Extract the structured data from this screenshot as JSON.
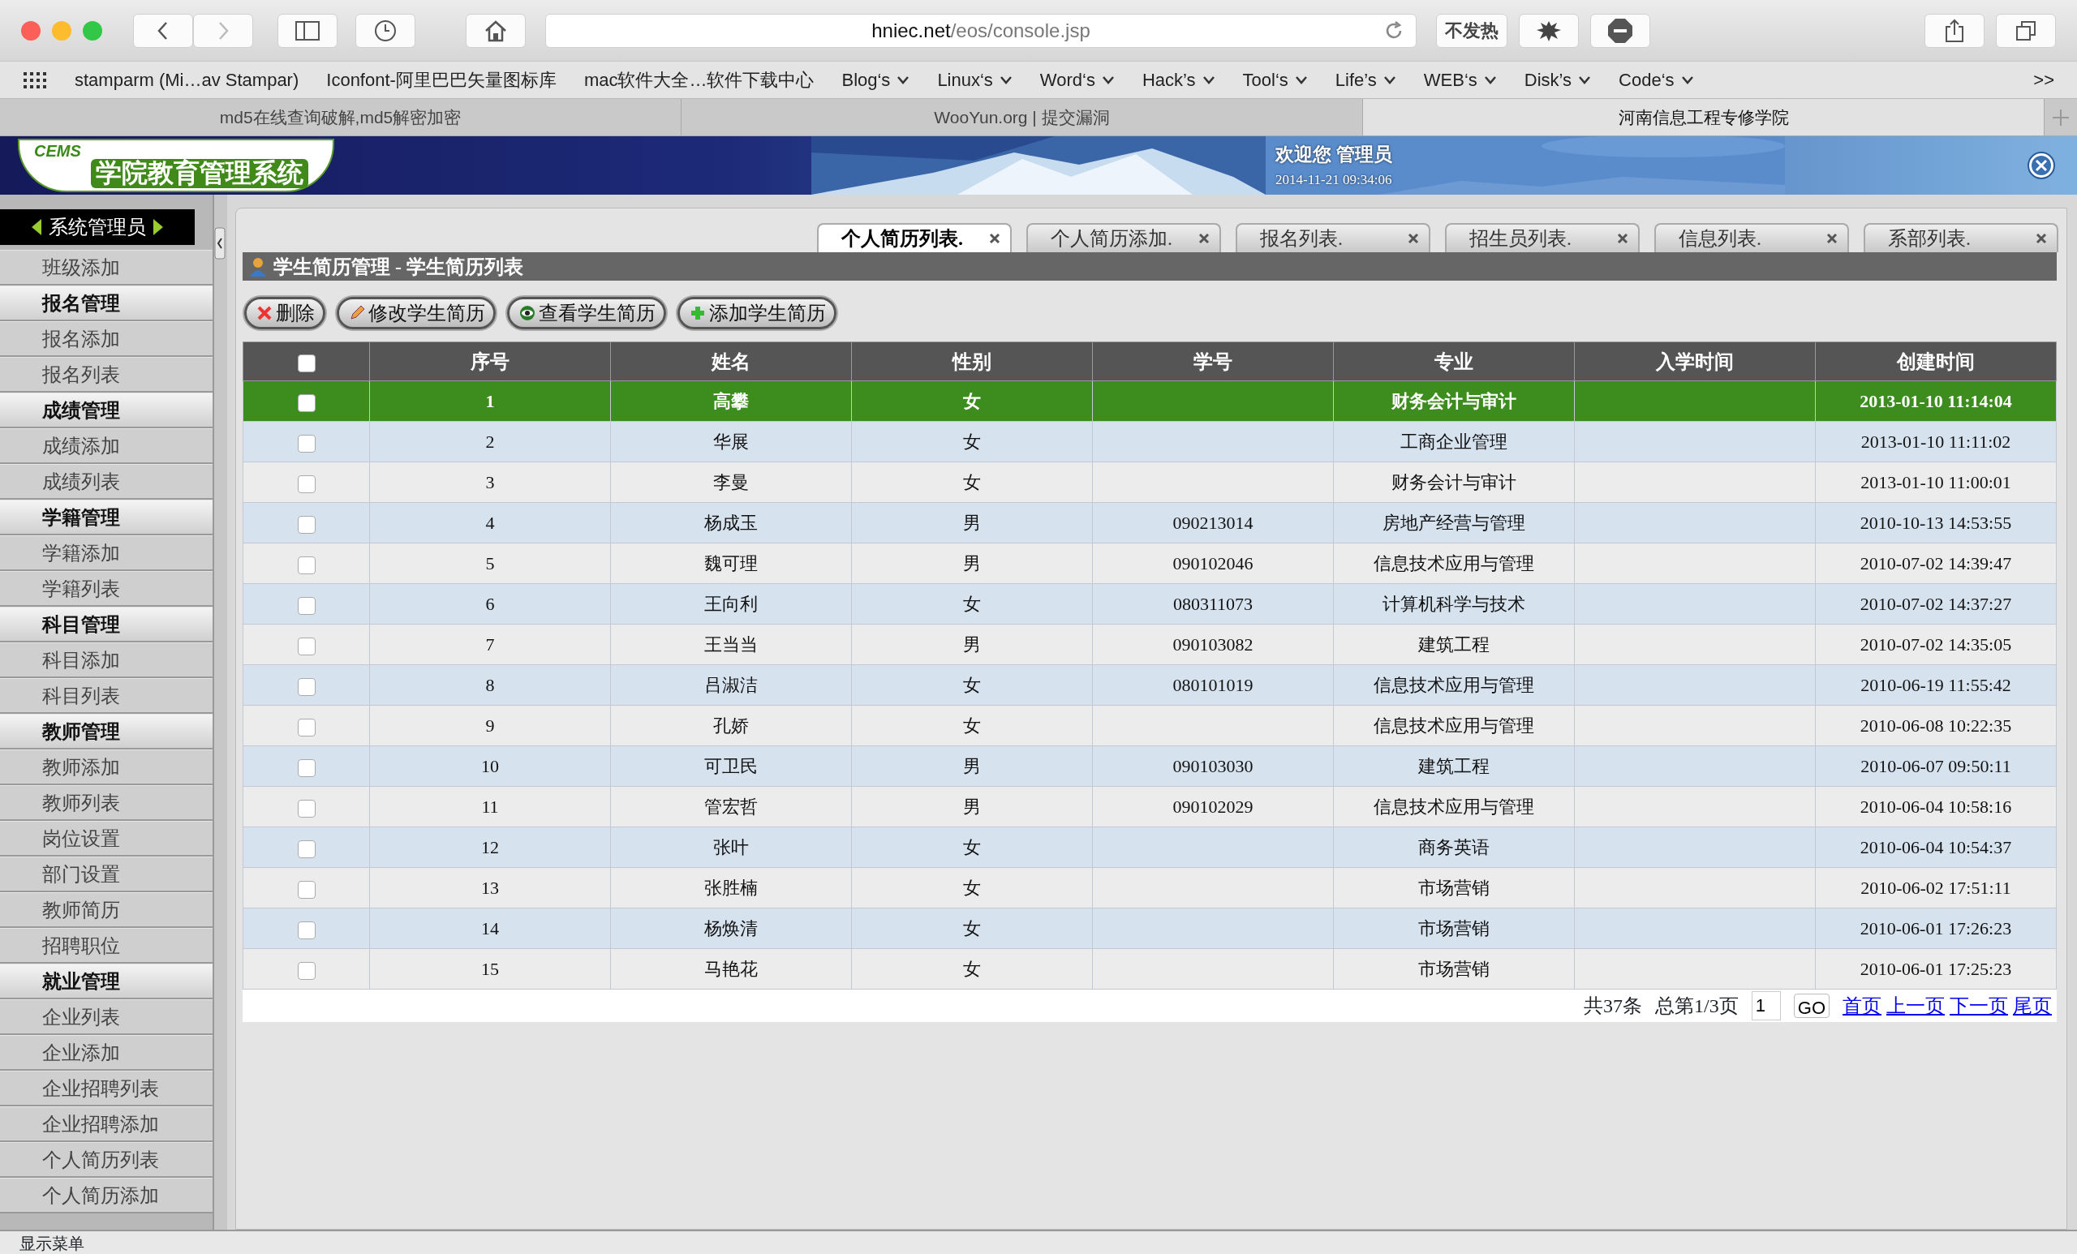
{
  "browser": {
    "url_host": "hniec.net",
    "url_path": "/eos/console.jsp",
    "ext_text": "不发热",
    "bookmarks": [
      {
        "label": "stamparm (Mi…av Stampar)",
        "menu": false
      },
      {
        "label": "Iconfont-阿里巴巴矢量图标库",
        "menu": false
      },
      {
        "label": "mac软件大全…软件下载中心",
        "menu": false
      },
      {
        "label": "Blog‘s",
        "menu": true
      },
      {
        "label": "Linux‘s",
        "menu": true
      },
      {
        "label": "Word‘s",
        "menu": true
      },
      {
        "label": "Hack’s",
        "menu": true
      },
      {
        "label": "Tool‘s",
        "menu": true
      },
      {
        "label": "Life’s",
        "menu": true
      },
      {
        "label": "WEB‘s",
        "menu": true
      },
      {
        "label": "Disk’s",
        "menu": true
      },
      {
        "label": "Code‘s",
        "menu": true
      }
    ],
    "more": ">>",
    "tabs": [
      {
        "label": "md5在线查询破解,md5解密加密",
        "selected": false
      },
      {
        "label": "WooYun.org | 提交漏洞",
        "selected": false
      },
      {
        "label": "河南信息工程专修学院",
        "selected": true
      }
    ]
  },
  "header": {
    "logo_small": "CEMS",
    "logo_title": "学院教育管理系统",
    "welcome": "欢迎您 管理员",
    "datetime": "2014-11-21 09:34:06"
  },
  "sidebar": {
    "title": "系统管理员",
    "items": [
      {
        "label": "班级添加",
        "kind": "item"
      },
      {
        "label": "报名管理",
        "kind": "group"
      },
      {
        "label": "报名添加",
        "kind": "item"
      },
      {
        "label": "报名列表",
        "kind": "item"
      },
      {
        "label": "成绩管理",
        "kind": "group"
      },
      {
        "label": "成绩添加",
        "kind": "item"
      },
      {
        "label": "成绩列表",
        "kind": "item"
      },
      {
        "label": "学籍管理",
        "kind": "group"
      },
      {
        "label": "学籍添加",
        "kind": "item"
      },
      {
        "label": "学籍列表",
        "kind": "item"
      },
      {
        "label": "科目管理",
        "kind": "group"
      },
      {
        "label": "科目添加",
        "kind": "item"
      },
      {
        "label": "科目列表",
        "kind": "item"
      },
      {
        "label": "教师管理",
        "kind": "group"
      },
      {
        "label": "教师添加",
        "kind": "item"
      },
      {
        "label": "教师列表",
        "kind": "item"
      },
      {
        "label": "岗位设置",
        "kind": "item"
      },
      {
        "label": "部门设置",
        "kind": "item"
      },
      {
        "label": "教师简历",
        "kind": "item"
      },
      {
        "label": "招聘职位",
        "kind": "item"
      },
      {
        "label": "就业管理",
        "kind": "group"
      },
      {
        "label": "企业列表",
        "kind": "item"
      },
      {
        "label": "企业添加",
        "kind": "item"
      },
      {
        "label": "企业招聘列表",
        "kind": "item"
      },
      {
        "label": "企业招聘添加",
        "kind": "item"
      },
      {
        "label": "个人简历列表",
        "kind": "item"
      },
      {
        "label": "个人简历添加",
        "kind": "item"
      }
    ]
  },
  "tabs": [
    {
      "label": "个人简历列表.",
      "selected": true
    },
    {
      "label": "个人简历添加.",
      "selected": false
    },
    {
      "label": "报名列表.",
      "selected": false
    },
    {
      "label": "招生员列表.",
      "selected": false
    },
    {
      "label": "信息列表.",
      "selected": false
    },
    {
      "label": "系部列表.",
      "selected": false
    }
  ],
  "panel_title": "学生简历管理 - 学生简历列表",
  "actions": [
    {
      "label": "删除",
      "kind": "delete"
    },
    {
      "label": "修改学生简历",
      "kind": "edit"
    },
    {
      "label": "查看学生简历",
      "kind": "view"
    },
    {
      "label": "添加学生简历",
      "kind": "add"
    }
  ],
  "table": {
    "select_all": {
      "checked": false
    },
    "columns": [
      "序号",
      "姓名",
      "性别",
      "学号",
      "专业",
      "入学时间",
      "创建时间"
    ],
    "rows": [
      {
        "selected": true,
        "checked": false,
        "cells": [
          "1",
          "高攀",
          "女",
          "",
          "财务会计与审计",
          "",
          "2013-01-10 11:14:04"
        ]
      },
      {
        "selected": false,
        "checked": false,
        "cells": [
          "2",
          "华展",
          "女",
          "",
          "工商企业管理",
          "",
          "2013-01-10 11:11:02"
        ]
      },
      {
        "selected": false,
        "checked": false,
        "cells": [
          "3",
          "李曼",
          "女",
          "",
          "财务会计与审计",
          "",
          "2013-01-10 11:00:01"
        ]
      },
      {
        "selected": false,
        "checked": false,
        "cells": [
          "4",
          "杨成玉",
          "男",
          "090213014",
          "房地产经营与管理",
          "",
          "2010-10-13 14:53:55"
        ]
      },
      {
        "selected": false,
        "checked": false,
        "cells": [
          "5",
          "魏可理",
          "男",
          "090102046",
          "信息技术应用与管理",
          "",
          "2010-07-02 14:39:47"
        ]
      },
      {
        "selected": false,
        "checked": false,
        "cells": [
          "6",
          "王向利",
          "女",
          "080311073",
          "计算机科学与技术",
          "",
          "2010-07-02 14:37:27"
        ]
      },
      {
        "selected": false,
        "checked": false,
        "cells": [
          "7",
          "王当当",
          "男",
          "090103082",
          "建筑工程",
          "",
          "2010-07-02 14:35:05"
        ]
      },
      {
        "selected": false,
        "checked": false,
        "cells": [
          "8",
          "吕淑洁",
          "女",
          "080101019",
          "信息技术应用与管理",
          "",
          "2010-06-19 11:55:42"
        ]
      },
      {
        "selected": false,
        "checked": false,
        "cells": [
          "9",
          "孔娇",
          "女",
          "",
          "信息技术应用与管理",
          "",
          "2010-06-08 10:22:35"
        ]
      },
      {
        "selected": false,
        "checked": false,
        "cells": [
          "10",
          "可卫民",
          "男",
          "090103030",
          "建筑工程",
          "",
          "2010-06-07 09:50:11"
        ]
      },
      {
        "selected": false,
        "checked": false,
        "cells": [
          "11",
          "管宏哲",
          "男",
          "090102029",
          "信息技术应用与管理",
          "",
          "2010-06-04 10:58:16"
        ]
      },
      {
        "selected": false,
        "checked": false,
        "cells": [
          "12",
          "张叶",
          "女",
          "",
          "商务英语",
          "",
          "2010-06-04 10:54:37"
        ]
      },
      {
        "selected": false,
        "checked": false,
        "cells": [
          "13",
          "张胜楠",
          "女",
          "",
          "市场营销",
          "",
          "2010-06-02 17:51:11"
        ]
      },
      {
        "selected": false,
        "checked": false,
        "cells": [
          "14",
          "杨焕清",
          "女",
          "",
          "市场营销",
          "",
          "2010-06-01 17:26:23"
        ]
      },
      {
        "selected": false,
        "checked": false,
        "cells": [
          "15",
          "马艳花",
          "女",
          "",
          "市场营销",
          "",
          "2010-06-01 17:25:23"
        ]
      }
    ]
  },
  "pagination": {
    "total": "共37条",
    "page": "总第1/3页",
    "page_input": "1",
    "go": "GO",
    "links": [
      "首页",
      "上一页",
      "下一页",
      "尾页"
    ]
  },
  "status_bar": "显示菜单"
}
